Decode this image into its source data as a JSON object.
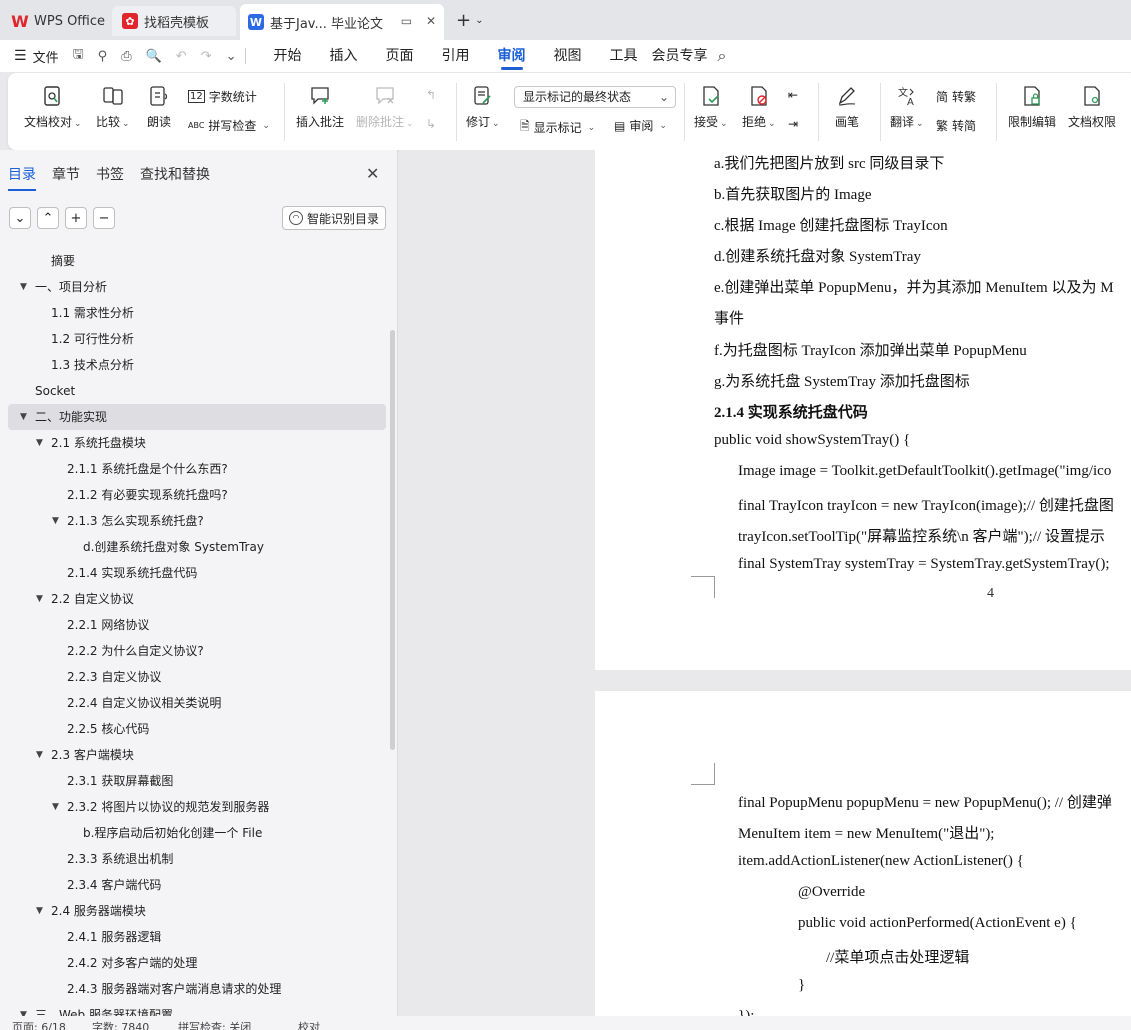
{
  "tabs": {
    "wps": "WPS Office",
    "templates": "找稻壳模板",
    "doc": "基于Jav... 毕业论文"
  },
  "menu": {
    "file": "文件",
    "tabs": [
      "开始",
      "插入",
      "页面",
      "引用",
      "审阅",
      "视图",
      "工具",
      "会员专享"
    ],
    "active": "审阅"
  },
  "ribbon": {
    "doc_check": "文档校对",
    "compare": "比较",
    "read_aloud": "朗读",
    "word_count": "字数统计",
    "spell_check": "拼写检查",
    "insert_comment": "插入批注",
    "delete_comment": "删除批注",
    "track": "修订",
    "markup_select": "显示标记的最终状态",
    "show_markup": "显示标记",
    "review": "审阅",
    "accept": "接受",
    "reject": "拒绝",
    "pen": "画笔",
    "translate": "翻译",
    "to_traditional": "转繁",
    "to_simplified": "转简",
    "restrict_edit": "限制编辑",
    "doc_permission": "文档权限"
  },
  "nav": {
    "tabs": [
      "目录",
      "章节",
      "书签",
      "查找和替换"
    ],
    "smart_toc": "智能识别目录",
    "toc": [
      {
        "label": "摘要"
      },
      {
        "label": "一、项目分析"
      },
      {
        "label": "1.1 需求性分析"
      },
      {
        "label": "1.2 可行性分析"
      },
      {
        "label": "1.3 技术点分析"
      },
      {
        "label": "Socket"
      },
      {
        "label": "二、功能实现"
      },
      {
        "label": "2.1 系统托盘模块"
      },
      {
        "label": "2.1.1 系统托盘是个什么东西?"
      },
      {
        "label": "2.1.2 有必要实现系统托盘吗?"
      },
      {
        "label": "2.1.3 怎么实现系统托盘?"
      },
      {
        "label": "d.创建系统托盘对象 SystemTray"
      },
      {
        "label": "2.1.4 实现系统托盘代码"
      },
      {
        "label": "2.2 自定义协议"
      },
      {
        "label": "2.2.1 网络协议"
      },
      {
        "label": "2.2.2 为什么自定义协议?"
      },
      {
        "label": "2.2.3 自定义协议"
      },
      {
        "label": "2.2.4 自定义协议相关类说明"
      },
      {
        "label": "2.2.5 核心代码"
      },
      {
        "label": "2.3 客户端模块"
      },
      {
        "label": "2.3.1 获取屏幕截图"
      },
      {
        "label": "2.3.2 将图片以协议的规范发到服务器"
      },
      {
        "label": "b.程序启动后初始化创建一个 File"
      },
      {
        "label": "2.3.3 系统退出机制"
      },
      {
        "label": "2.3.4 客户端代码"
      },
      {
        "label": "2.4 服务器端模块"
      },
      {
        "label": "2.4.1 服务器逻辑"
      },
      {
        "label": "2.4.2 对多客户端的处理"
      },
      {
        "label": "2.4.3 服务器端对客户端消息请求的处理"
      },
      {
        "label": "三、Web 服务器环境配置"
      }
    ]
  },
  "doc": {
    "page1_lines": [
      "a.我们先把图片放到 src 同级目录下",
      "b.首先获取图片的 Image",
      "c.根据 Image 创建托盘图标 TrayIcon",
      "d.创建系统托盘对象 SystemTray",
      "e.创建弹出菜单 PopupMenu，并为其添加 MenuItem 以及为 M",
      "事件",
      "f.为托盘图标 TrayIcon 添加弹出菜单 PopupMenu",
      "g.为系统托盘 SystemTray 添加托盘图标",
      "2.1.4 实现系统托盘代码",
      "public void showSystemTray() {",
      "Image image = Toolkit.getDefaultToolkit().getImage(\"img/ico",
      "final TrayIcon trayIcon = new TrayIcon(image);//  创建托盘图",
      "trayIcon.setToolTip(\"屏幕监控系统\\n 客户端\");//  设置提示",
      "final SystemTray systemTray = SystemTray.getSystemTray();"
    ],
    "page_number": "4",
    "page2_lines": [
      "final PopupMenu popupMenu = new PopupMenu(); //  创建弹",
      "MenuItem item = new MenuItem(\"退出\");",
      "item.addActionListener(new ActionListener() {",
      "@Override",
      "public void actionPerformed(ActionEvent e) {",
      "//菜单项点击处理逻辑",
      "}",
      "});"
    ]
  },
  "status": {
    "page": "页面: 6/18",
    "words": "字数: 7840",
    "spell": "拼写检查: 关闭",
    "proof": "校对"
  }
}
